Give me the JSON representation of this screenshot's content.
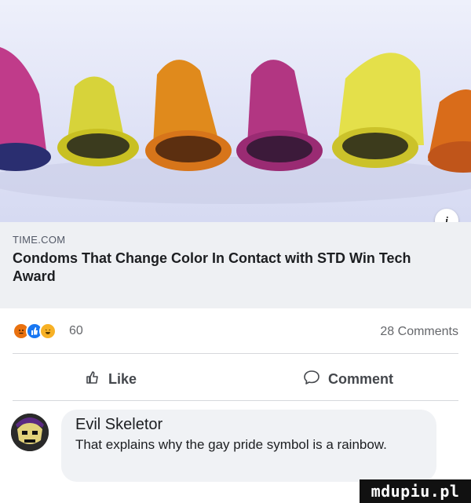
{
  "link_preview": {
    "domain": "TIME.COM",
    "title": "Condoms That Change Color In Contact with STD Win Tech Award",
    "info_icon": "info-icon"
  },
  "reactions": {
    "count": "60",
    "icons": [
      "angry-reaction-icon",
      "like-reaction-icon",
      "laugh-reaction-icon"
    ],
    "colors": {
      "angry": "#e9710f",
      "like": "#1877f2",
      "laugh": "#f7b125"
    }
  },
  "comments_count": "28 Comments",
  "actions": {
    "like_label": "Like",
    "comment_label": "Comment"
  },
  "comment": {
    "author": "Evil Skeletor",
    "text": "That explains why the gay pride symbol is a rainbow."
  },
  "watermark": "mdupiu.pl"
}
